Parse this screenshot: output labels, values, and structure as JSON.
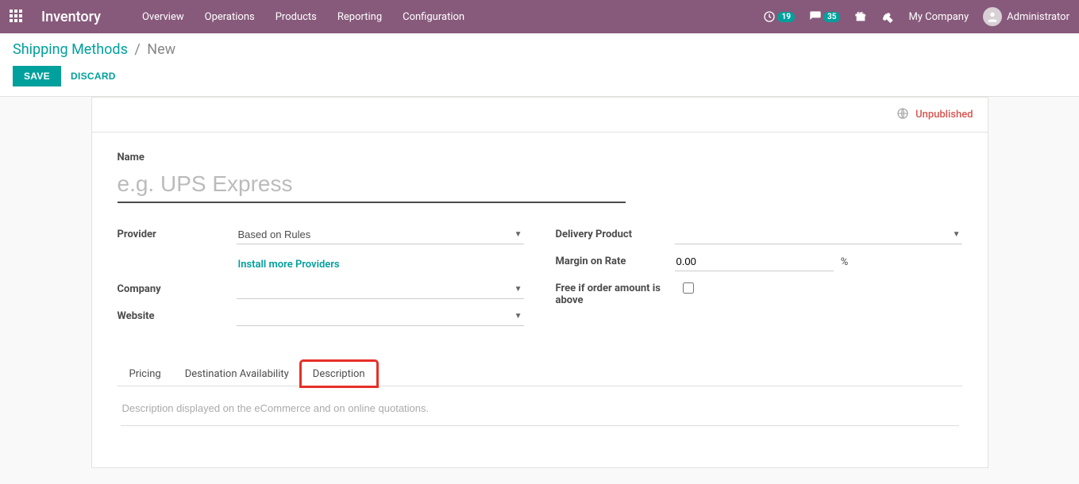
{
  "navbar": {
    "brand": "Inventory",
    "menu": [
      "Overview",
      "Operations",
      "Products",
      "Reporting",
      "Configuration"
    ],
    "clock_badge": "19",
    "chat_badge": "35",
    "company": "My Company",
    "user": "Administrator"
  },
  "breadcrumb": {
    "parent": "Shipping Methods",
    "current": "New"
  },
  "buttons": {
    "save": "Save",
    "discard": "Discard"
  },
  "status": {
    "label": "Unpublished"
  },
  "form": {
    "name_label": "Name",
    "name_placeholder": "e.g. UPS Express",
    "name_value": "",
    "left": {
      "provider_label": "Provider",
      "provider_value": "Based on Rules",
      "install_link": "Install more Providers",
      "company_label": "Company",
      "company_value": "",
      "website_label": "Website",
      "website_value": ""
    },
    "right": {
      "delivery_product_label": "Delivery Product",
      "delivery_product_value": "",
      "margin_label": "Margin on Rate",
      "margin_value": "0.00",
      "margin_unit": "%",
      "free_label": "Free if order amount is above",
      "free_checked": false
    }
  },
  "tabs": {
    "items": [
      "Pricing",
      "Destination Availability",
      "Description"
    ],
    "active": 2,
    "highlight": 2,
    "description_placeholder": "Description displayed on the eCommerce and on online quotations.",
    "description_value": ""
  }
}
